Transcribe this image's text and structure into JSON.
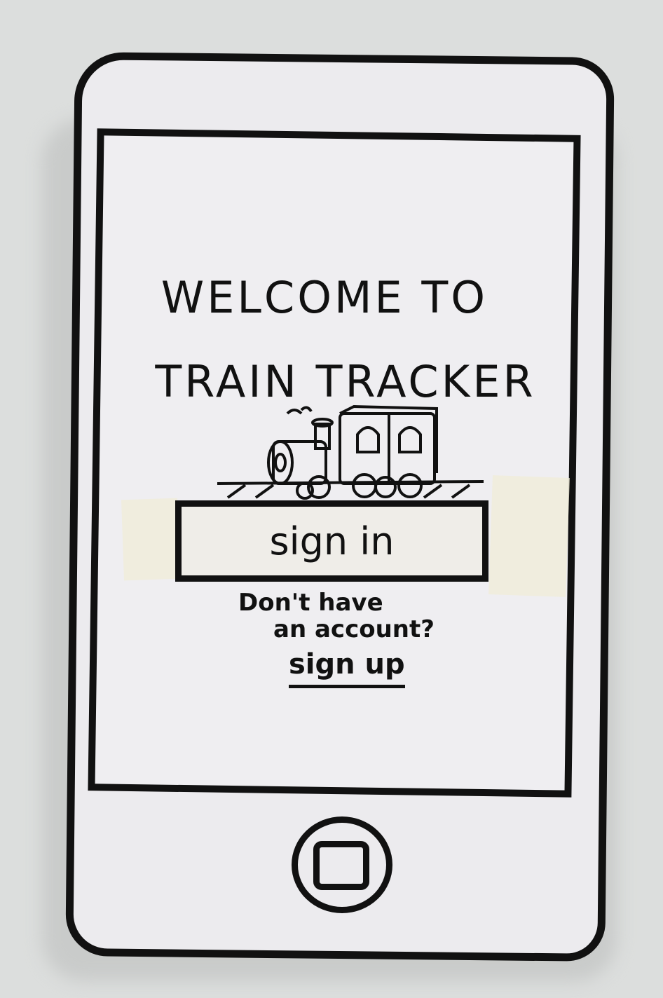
{
  "welcome": {
    "line1": "WELCOME TO",
    "line2": "TRAIN TRACKER"
  },
  "auth": {
    "sign_in_label": "sign in",
    "prompt_line1": "Don't have",
    "prompt_line2": "an account?",
    "sign_up_label": "sign up"
  },
  "icons": {
    "logo": "train-icon",
    "home": "home-button-icon"
  }
}
